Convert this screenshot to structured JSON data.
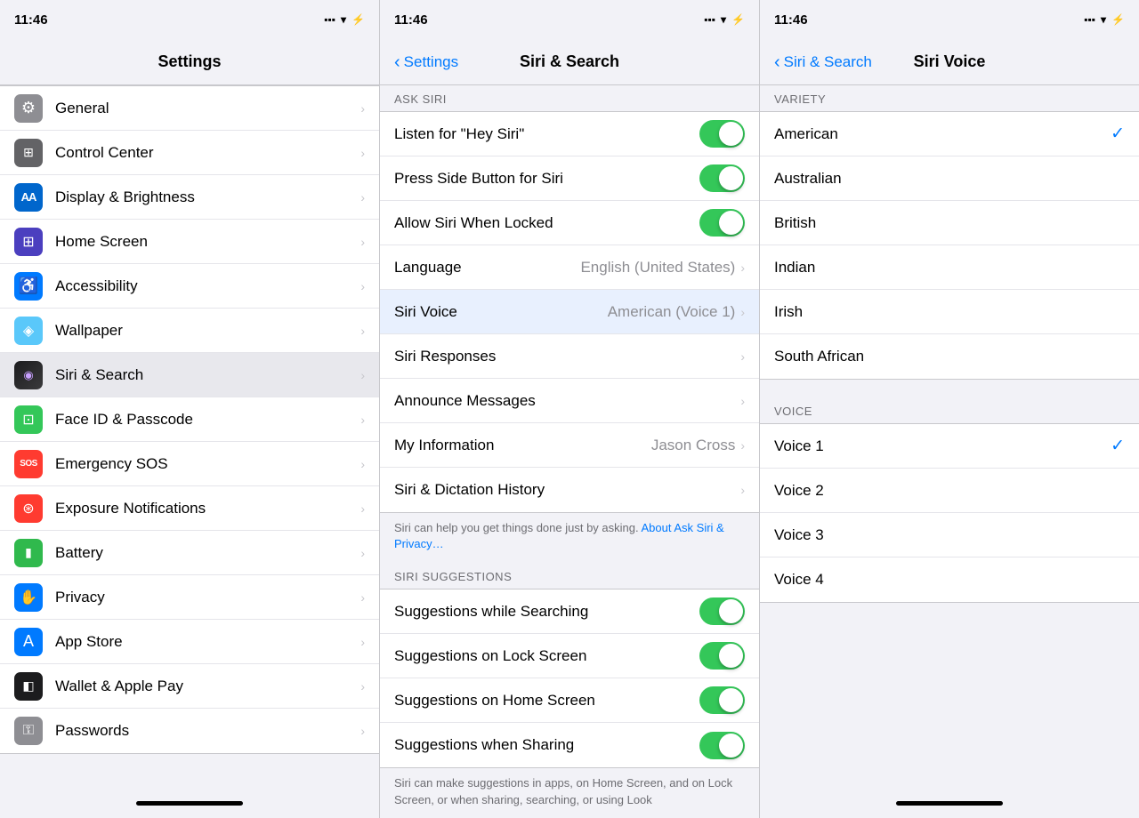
{
  "panel1": {
    "status": {
      "time": "11:46",
      "icons": "●▲⚡"
    },
    "title": "Settings",
    "items": [
      {
        "id": "general",
        "label": "General",
        "icon": "⚙️",
        "bg": "bg-gray",
        "unicode": "⚙"
      },
      {
        "id": "control-center",
        "label": "Control Center",
        "icon": "🎛",
        "bg": "bg-gray",
        "unicode": "⊞"
      },
      {
        "id": "display",
        "label": "Display & Brightness",
        "icon": "AA",
        "bg": "bg-blue-aa",
        "unicode": "AA"
      },
      {
        "id": "home-screen",
        "label": "Home Screen",
        "icon": "⊞",
        "bg": "bg-indigo",
        "unicode": "⊞"
      },
      {
        "id": "accessibility",
        "label": "Accessibility",
        "icon": "♿",
        "bg": "bg-blue",
        "unicode": "♿"
      },
      {
        "id": "wallpaper",
        "label": "Wallpaper",
        "icon": "🌅",
        "bg": "bg-teal",
        "unicode": "◈"
      },
      {
        "id": "siri",
        "label": "Siri & Search",
        "icon": "S",
        "bg": "bg-siri",
        "unicode": "⊙",
        "highlighted": true
      },
      {
        "id": "face-id",
        "label": "Face ID & Passcode",
        "icon": "👤",
        "bg": "bg-green-bright",
        "unicode": "⊡"
      },
      {
        "id": "emergency-sos",
        "label": "Emergency SOS",
        "icon": "SOS",
        "bg": "bg-red",
        "unicode": "SOS"
      },
      {
        "id": "exposure",
        "label": "Exposure Notifications",
        "icon": "☣",
        "bg": "bg-red",
        "unicode": "⊛"
      },
      {
        "id": "battery",
        "label": "Battery",
        "icon": "🔋",
        "bg": "bg-green",
        "unicode": "▮"
      },
      {
        "id": "privacy",
        "label": "Privacy",
        "icon": "🤚",
        "bg": "bg-blue",
        "unicode": "✋"
      },
      {
        "id": "app-store",
        "label": "App Store",
        "icon": "A",
        "bg": "bg-blue",
        "unicode": "A"
      },
      {
        "id": "wallet",
        "label": "Wallet & Apple Pay",
        "icon": "💳",
        "bg": "bg-dark-gray",
        "unicode": "◧"
      },
      {
        "id": "passwords",
        "label": "Passwords",
        "icon": "🔑",
        "bg": "bg-gray",
        "unicode": "⚿"
      }
    ]
  },
  "panel2": {
    "status": {
      "time": "11:46"
    },
    "back_label": "Settings",
    "title": "Siri & Search",
    "ask_siri_label": "ASK SIRI",
    "siri_suggestions_label": "SIRI SUGGESTIONS",
    "items_ask": [
      {
        "id": "hey-siri",
        "label": "Listen for \"Hey Siri\"",
        "toggle": true
      },
      {
        "id": "side-button",
        "label": "Press Side Button for Siri",
        "toggle": true
      },
      {
        "id": "allow-locked",
        "label": "Allow Siri When Locked",
        "toggle": true
      },
      {
        "id": "language",
        "label": "Language",
        "value": "English (United States)",
        "toggle": false
      },
      {
        "id": "siri-voice",
        "label": "Siri Voice",
        "value": "American (Voice 1)",
        "toggle": false
      },
      {
        "id": "siri-responses",
        "label": "Siri Responses",
        "toggle": false
      },
      {
        "id": "announce-messages",
        "label": "Announce Messages",
        "toggle": false
      },
      {
        "id": "my-info",
        "label": "My Information",
        "value": "Jason Cross",
        "toggle": false
      },
      {
        "id": "dictation-history",
        "label": "Siri & Dictation History",
        "toggle": false
      }
    ],
    "siri_note": "Siri can help you get things done just by asking.",
    "siri_link": "About Ask Siri & Privacy…",
    "items_suggestions": [
      {
        "id": "suggestions-searching",
        "label": "Suggestions while Searching",
        "toggle": true
      },
      {
        "id": "suggestions-lock",
        "label": "Suggestions on Lock Screen",
        "toggle": true
      },
      {
        "id": "suggestions-home",
        "label": "Suggestions on Home Screen",
        "toggle": true
      },
      {
        "id": "suggestions-sharing",
        "label": "Suggestions when Sharing",
        "toggle": true
      }
    ],
    "suggestions_note": "Siri can make suggestions in apps, on Home Screen, and on Lock Screen, or when sharing, searching, or using Look"
  },
  "panel3": {
    "status": {
      "time": "11:46"
    },
    "back_label": "Siri & Search",
    "title": "Siri Voice",
    "variety_label": "VARIETY",
    "variety_items": [
      {
        "id": "american",
        "label": "American",
        "selected": true
      },
      {
        "id": "australian",
        "label": "Australian",
        "selected": false
      },
      {
        "id": "british",
        "label": "British",
        "selected": false
      },
      {
        "id": "indian",
        "label": "Indian",
        "selected": false
      },
      {
        "id": "irish",
        "label": "Irish",
        "selected": false
      },
      {
        "id": "south-african",
        "label": "South African",
        "selected": false
      }
    ],
    "voice_label": "VOICE",
    "voice_items": [
      {
        "id": "voice1",
        "label": "Voice 1",
        "selected": true
      },
      {
        "id": "voice2",
        "label": "Voice 2",
        "selected": false
      },
      {
        "id": "voice3",
        "label": "Voice 3",
        "selected": false
      },
      {
        "id": "voice4",
        "label": "Voice 4",
        "selected": false
      }
    ]
  }
}
